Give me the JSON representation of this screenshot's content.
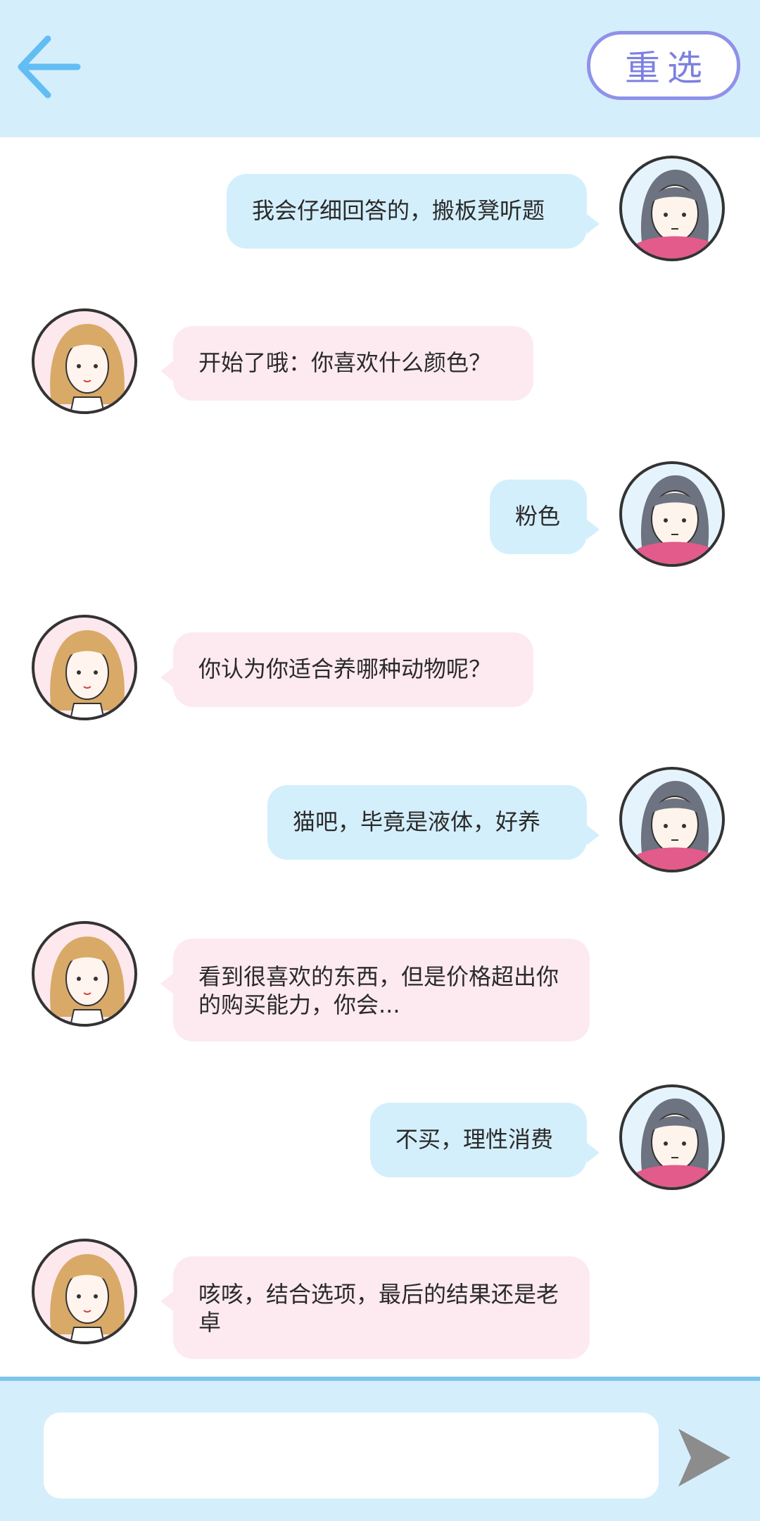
{
  "header": {
    "back_icon": "left-arrow-icon",
    "reselect_label": "重选"
  },
  "colors": {
    "header_bg": "#d5eefc",
    "accent_blue": "#62bdf3",
    "reselect_purple": "#8f92e8",
    "host_bubble": "#fdeaf0",
    "user_bubble": "#d4effc",
    "send_icon": "#8c8c8c"
  },
  "messages": [
    {
      "sender": "user",
      "text": "我会仔细回答的，搬板凳听题"
    },
    {
      "sender": "host",
      "text": "开始了哦：你喜欢什么颜色？"
    },
    {
      "sender": "user",
      "text": "粉色"
    },
    {
      "sender": "host",
      "text": "你认为你适合养哪种动物呢？"
    },
    {
      "sender": "user",
      "text": "猫吧，毕竟是液体，好养"
    },
    {
      "sender": "host",
      "text": "看到很喜欢的东西，但是价格超出你的购买能力，你会..."
    },
    {
      "sender": "user",
      "text": "不买，理性消费"
    },
    {
      "sender": "host",
      "text": "咳咳，结合选项，最后的结果还是老卓"
    }
  ],
  "composer": {
    "input_value": "",
    "send_icon": "send-arrow-icon"
  }
}
